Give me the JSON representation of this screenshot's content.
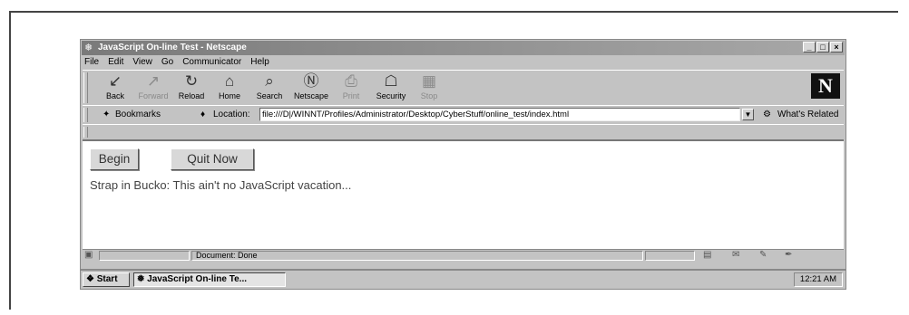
{
  "window": {
    "title": "JavaScript On-line Test - Netscape",
    "min": "_",
    "max": "□",
    "close": "×"
  },
  "menu": [
    "File",
    "Edit",
    "View",
    "Go",
    "Communicator",
    "Help"
  ],
  "toolbar": {
    "buttons": [
      {
        "label": "Back",
        "icon": "back-arrow-icon",
        "glyph": "↙"
      },
      {
        "label": "Forward",
        "icon": "forward-arrow-icon",
        "glyph": "↗"
      },
      {
        "label": "Reload",
        "icon": "reload-icon",
        "glyph": "↻"
      },
      {
        "label": "Home",
        "icon": "home-icon",
        "glyph": "⌂"
      },
      {
        "label": "Search",
        "icon": "search-icon",
        "glyph": "⌕"
      },
      {
        "label": "Netscape",
        "icon": "netscape-icon",
        "glyph": "Ⓝ"
      },
      {
        "label": "Print",
        "icon": "print-icon",
        "glyph": "⎙"
      },
      {
        "label": "Security",
        "icon": "lock-icon",
        "glyph": "☖"
      },
      {
        "label": "Stop",
        "icon": "stop-icon",
        "glyph": "▦"
      }
    ],
    "logo": "N"
  },
  "location": {
    "bookmarks_label": "Bookmarks",
    "location_label": "Location:",
    "url": "file:///D|/WINNT/Profiles/Administrator/Desktop/CyberStuff/online_test/index.html",
    "related_label": "What's Related"
  },
  "content": {
    "begin_label": "Begin",
    "quit_label": "Quit Now",
    "message": "Strap in Bucko: This ain't no JavaScript vacation..."
  },
  "status": {
    "text": "Document: Done"
  },
  "taskbar": {
    "start": "Start",
    "task": "JavaScript On-line Te...",
    "time": "12:21 AM"
  }
}
